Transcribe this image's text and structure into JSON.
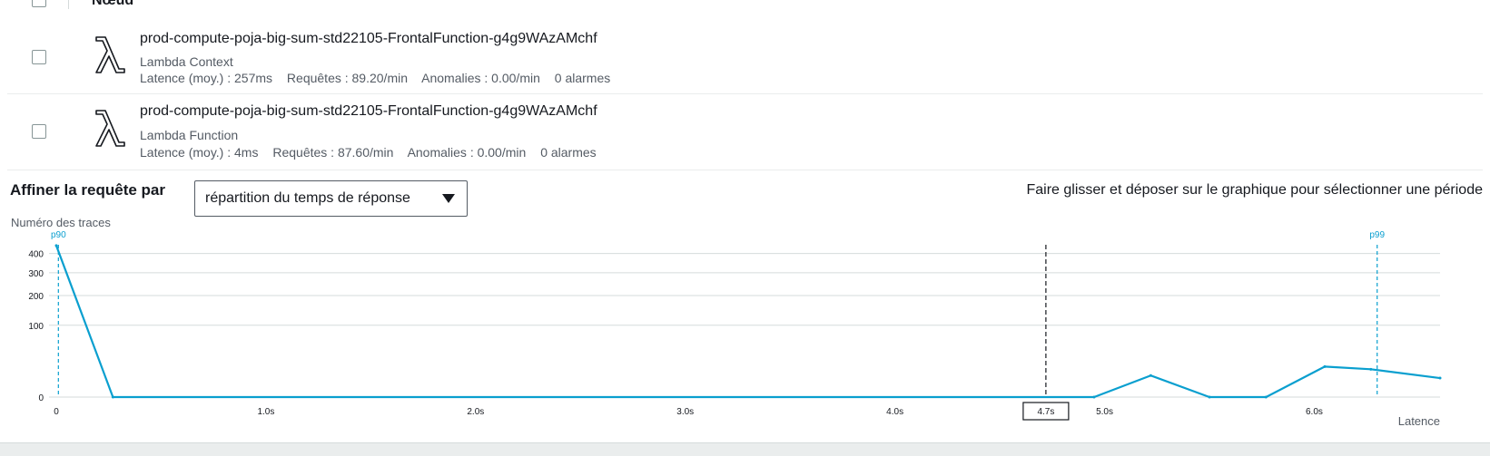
{
  "table": {
    "header_label": "Nœud",
    "rows": [
      {
        "title": "prod-compute-poja-big-sum-std22105-FrontalFunction-g4g9WAzAMchf",
        "type": "Lambda Context",
        "latency": "Latence (moy.) : 257ms",
        "requests": "Requêtes : 89.20/min",
        "anomalies": "Anomalies : 0.00/min",
        "alarms": "0 alarmes"
      },
      {
        "title": "prod-compute-poja-big-sum-std22105-FrontalFunction-g4g9WAzAMchf",
        "type": "Lambda Function",
        "latency": "Latence (moy.) : 4ms",
        "requests": "Requêtes : 87.60/min",
        "anomalies": "Anomalies : 0.00/min",
        "alarms": "0 alarmes"
      }
    ]
  },
  "refine": {
    "label": "Affiner la requête par",
    "select_value": "répartition du temps de réponse",
    "drag_hint": "Faire glisser et déposer sur le graphique pour sélectionner une période"
  },
  "colors": {
    "series": "#0a9fcf",
    "grid": "#d5dbdb",
    "selection_marker": "#16191f"
  },
  "chart_data": {
    "type": "line",
    "ylabel": "Numéro des traces",
    "xlabel": "Latence",
    "y_scale": "sqrt",
    "y_ticks": [
      0,
      100,
      200,
      300,
      400
    ],
    "ylim": [
      0,
      450
    ],
    "x_ticks": [
      {
        "value": 0,
        "label": "0"
      },
      {
        "value": 1.0,
        "label": "1.0s"
      },
      {
        "value": 2.0,
        "label": "2.0s"
      },
      {
        "value": 3.0,
        "label": "3.0s"
      },
      {
        "value": 4.0,
        "label": "4.0s"
      },
      {
        "value": 5.0,
        "label": "5.0s"
      },
      {
        "value": 6.0,
        "label": "6.0s"
      }
    ],
    "xlim": [
      0,
      6.6
    ],
    "series": [
      {
        "x": [
          0,
          0.27,
          4.95,
          5.22,
          5.5,
          5.77,
          6.05,
          6.27,
          6.6
        ],
        "y": [
          445,
          0,
          0,
          9,
          0,
          0,
          18,
          15,
          7
        ]
      }
    ],
    "markers": [
      {
        "label": "p90",
        "x": 0.01
      },
      {
        "label": "p99",
        "x": 6.3
      }
    ],
    "selection": {
      "x": 4.72,
      "label": "4.7s"
    }
  }
}
